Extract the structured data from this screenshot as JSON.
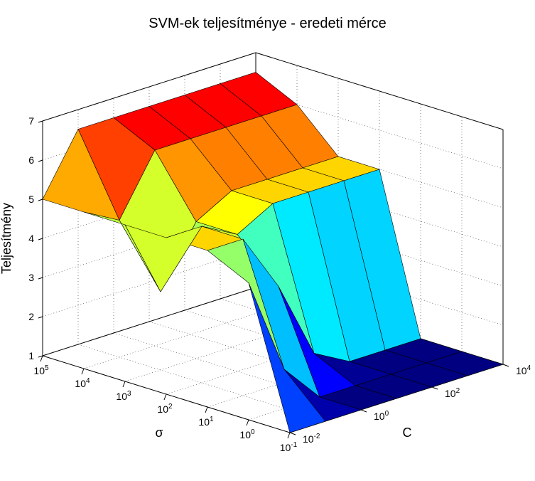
{
  "title": "SVM-ek teljesítménye - eredeti mérce",
  "axes": {
    "x": {
      "label": "σ",
      "ticks": [
        "10^-1",
        "10^0",
        "10^1",
        "10^2",
        "10^3",
        "10^4",
        "10^5"
      ]
    },
    "y": {
      "label": "C",
      "ticks": [
        "10^-2",
        "10^0",
        "10^2",
        "10^4"
      ]
    },
    "z": {
      "label": "Teljesítmény",
      "ticks": [
        "1",
        "2",
        "3",
        "4",
        "5",
        "6",
        "7"
      ]
    }
  },
  "chart_data": {
    "type": "surface3d",
    "title": "SVM-ek teljesítménye - eredeti mérce",
    "xlabel": "σ",
    "ylabel": "C",
    "zlabel": "Teljesítmény",
    "x_log_exponents": [
      -1,
      0,
      1,
      2,
      3,
      4,
      5
    ],
    "y_log_exponents": [
      -2,
      -1,
      0,
      1,
      2,
      3,
      4
    ],
    "zlim": [
      1,
      7
    ],
    "z": [
      [
        1.0,
        4.5,
        5.0,
        5.0,
        5.0,
        5.0,
        5.0
      ],
      [
        1.0,
        2.0,
        5.0,
        5.0,
        3.0,
        4.5,
        6.5
      ],
      [
        1.0,
        1.0,
        3.5,
        4.5,
        4.5,
        6.0,
        6.5
      ],
      [
        1.0,
        1.0,
        1.5,
        5.0,
        5.0,
        6.0,
        6.5
      ],
      [
        1.0,
        1.0,
        1.0,
        5.0,
        5.0,
        6.0,
        6.5
      ],
      [
        1.0,
        1.0,
        1.0,
        5.0,
        5.0,
        6.0,
        6.5
      ],
      [
        1.0,
        1.0,
        1.0,
        5.0,
        5.0,
        6.0,
        6.5
      ]
    ],
    "colormap": "jet"
  }
}
